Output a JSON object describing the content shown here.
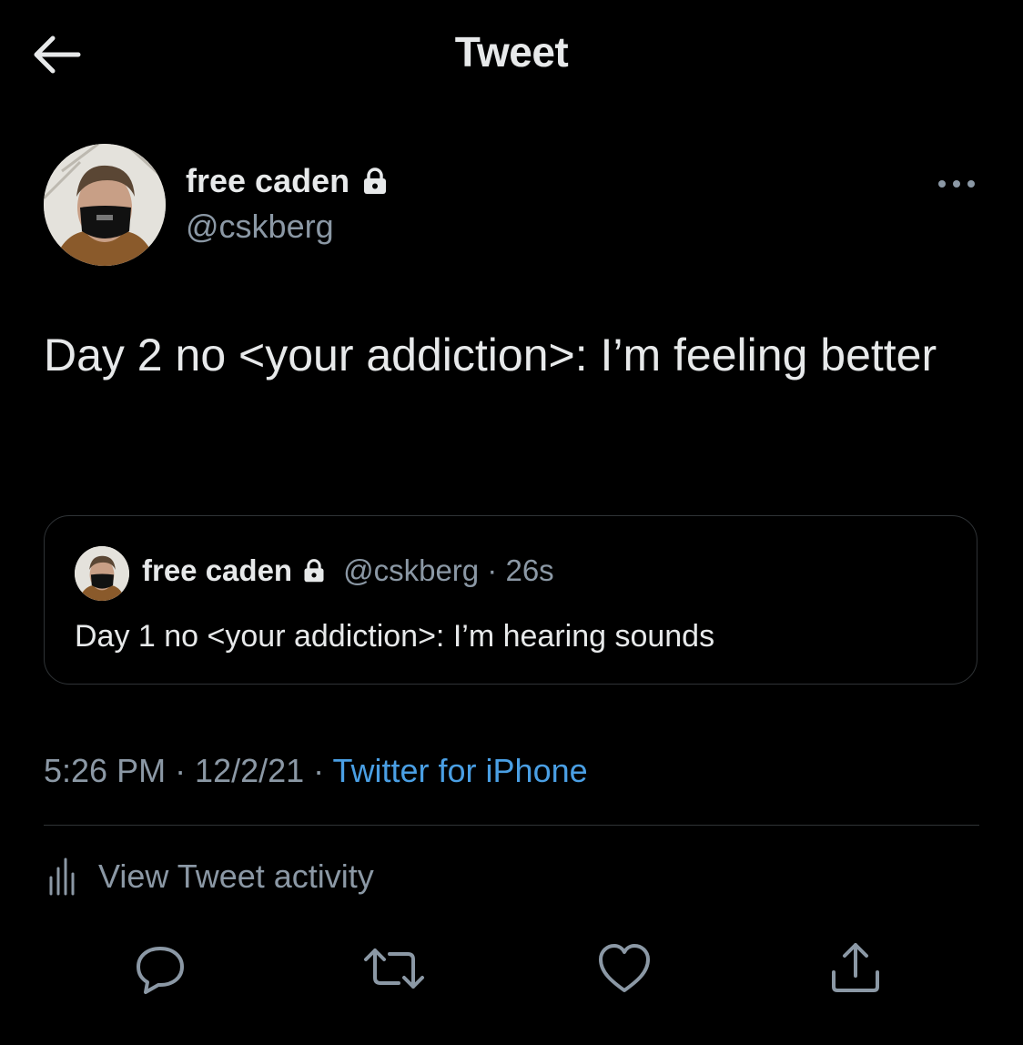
{
  "header": {
    "title": "Tweet"
  },
  "tweet": {
    "author_name": "free caden",
    "handle": "@cskberg",
    "text": "Day 2 no <your addiction>: I’m feeling better",
    "timestamp": "5:26 PM · 12/2/21 · ",
    "source": "Twitter for iPhone"
  },
  "quote": {
    "author_name": "free caden",
    "meta": "@cskberg · 26s",
    "text": "Day 1 no <your addiction>: I’m hearing sounds"
  },
  "activity": {
    "label": "View Tweet activity"
  },
  "icons": {
    "back": "arrow-left-icon",
    "more": "more-horizontal-icon",
    "lock": "lock-icon",
    "analytics": "analytics-icon",
    "reply": "reply-icon",
    "retweet": "retweet-icon",
    "like": "heart-icon",
    "share": "share-icon"
  },
  "colors": {
    "background": "#000000",
    "text": "#e7e9ea",
    "secondary": "#8b98a5",
    "link": "#4a9fe4",
    "border": "#2f3336"
  }
}
